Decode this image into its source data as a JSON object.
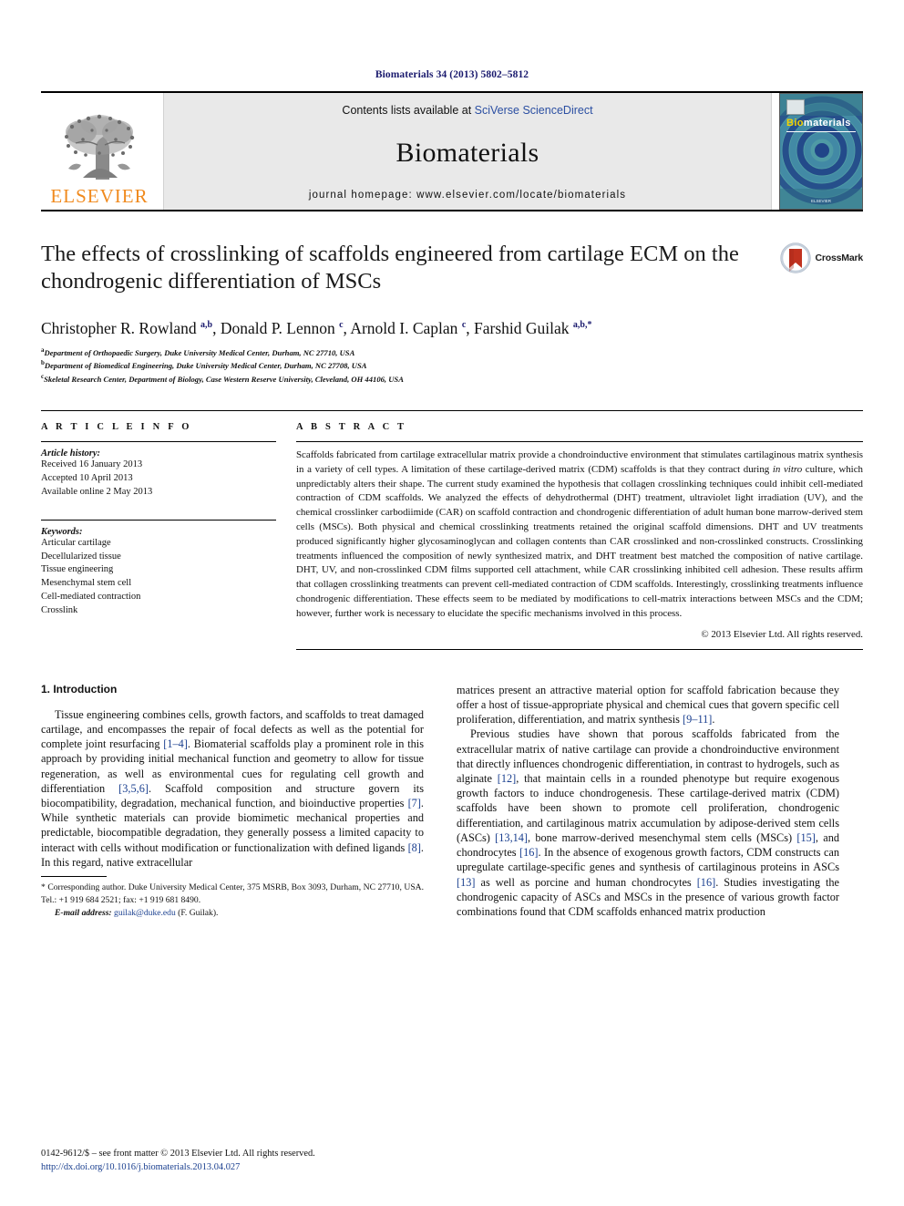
{
  "running_head": "Biomaterials 34 (2013) 5802–5812",
  "masthead": {
    "publisher_name": "ELSEVIER",
    "contents_prefix": "Contents lists available at ",
    "contents_link": "SciVerse ScienceDirect",
    "journal_title": "Biomaterials",
    "homepage": "journal homepage: www.elsevier.com/locate/biomaterials",
    "cover_word_bio": "Bio",
    "cover_word_materials": "materials",
    "cover_footer": "ELSEVIER"
  },
  "article": {
    "title": "The effects of crosslinking of scaffolds engineered from cartilage ECM on the chondrogenic differentiation of MSCs",
    "crossmark_label": "CrossMark",
    "authors_html": "Christopher R. Rowland <sup>a,b</sup>, Donald P. Lennon <sup>c</sup>, Arnold I. Caplan <sup>c</sup>, Farshid Guilak <sup>a,b,</sup><sup>*</sup>",
    "affiliations": [
      "Department of Orthopaedic Surgery, Duke University Medical Center, Durham, NC 27710, USA",
      "Department of Biomedical Engineering, Duke University Medical Center, Durham, NC 27708, USA",
      "Skeletal Research Center, Department of Biology, Case Western Reserve University, Cleveland, OH 44106, USA"
    ],
    "affiliation_marks": [
      "a",
      "b",
      "c"
    ]
  },
  "article_info": {
    "heading": "A R T I C L E  I N F O",
    "history_label": "Article history:",
    "history": [
      "Received 16 January 2013",
      "Accepted 10 April 2013",
      "Available online 2 May 2013"
    ],
    "keywords_label": "Keywords:",
    "keywords": [
      "Articular cartilage",
      "Decellularized tissue",
      "Tissue engineering",
      "Mesenchymal stem cell",
      "Cell-mediated contraction",
      "Crosslink"
    ]
  },
  "abstract": {
    "heading": "A B S T R A C T",
    "paragraph_html": "Scaffolds fabricated from cartilage extracellular matrix provide a chondroinductive environment that stimulates cartilaginous matrix synthesis in a variety of cell types. A limitation of these cartilage-derived matrix (CDM) scaffolds is that they contract during <i>in vitro</i> culture, which unpredictably alters their shape. The current study examined the hypothesis that collagen crosslinking techniques could inhibit cell-mediated contraction of CDM scaffolds. We analyzed the effects of dehydrothermal (DHT) treatment, ultraviolet light irradiation (UV), and the chemical crosslinker carbodiimide (CAR) on scaffold contraction and chondrogenic differentiation of adult human bone marrow-derived stem cells (MSCs). Both physical and chemical crosslinking treatments retained the original scaffold dimensions. DHT and UV treatments produced significantly higher glycosaminoglycan and collagen contents than CAR crosslinked and non-crosslinked constructs. Crosslinking treatments influenced the composition of newly synthesized matrix, and DHT treatment best matched the composition of native cartilage. DHT, UV, and non-crosslinked CDM films supported cell attachment, while CAR crosslinking inhibited cell adhesion. These results affirm that collagen crosslinking treatments can prevent cell-mediated contraction of CDM scaffolds. Interestingly, crosslinking treatments influence chondrogenic differentiation. These effects seem to be mediated by modifications to cell-matrix interactions between MSCs and the CDM; however, further work is necessary to elucidate the specific mechanisms involved in this process.",
    "copyright": "© 2013 Elsevier Ltd. All rights reserved."
  },
  "introduction": {
    "section_number_title": "1. Introduction",
    "left_paragraph_html": "Tissue engineering combines cells, growth factors, and scaffolds to treat damaged cartilage, and encompasses the repair of focal defects as well as the potential for complete joint resurfacing <span class=\"ref\">[1–4]</span>. Biomaterial scaffolds play a prominent role in this approach by providing initial mechanical function and geometry to allow for tissue regeneration, as well as environmental cues for regulating cell growth and differentiation <span class=\"ref\">[3,5,6]</span>. Scaffold composition and structure govern its biocompatibility, degradation, mechanical function, and bioinductive properties <span class=\"ref\">[7]</span>. While synthetic materials can provide biomimetic mechanical properties and predictable, biocompatible degradation, they generally possess a limited capacity to interact with cells without modification or functionalization with defined ligands <span class=\"ref\">[8]</span>. In this regard, native extracellular",
    "right_paragraph_1_html": "matrices present an attractive material option for scaffold fabrication because they offer a host of tissue-appropriate physical and chemical cues that govern specific cell proliferation, differentiation, and matrix synthesis <span class=\"ref\">[9–11]</span>.",
    "right_paragraph_2_html": "Previous studies have shown that porous scaffolds fabricated from the extracellular matrix of native cartilage can provide a chondroinductive environment that directly influences chondrogenic differentiation, in contrast to hydrogels, such as alginate <span class=\"ref\">[12]</span>, that maintain cells in a rounded phenotype but require exogenous growth factors to induce chondrogenesis. These cartilage-derived matrix (CDM) scaffolds have been shown to promote cell proliferation, chondrogenic differentiation, and cartilaginous matrix accumulation by adipose-derived stem cells (ASCs) <span class=\"ref\">[13,14]</span>, bone marrow-derived mesenchymal stem cells (MSCs) <span class=\"ref\">[15]</span>, and chondrocytes <span class=\"ref\">[16]</span>. In the absence of exogenous growth factors, CDM constructs can upregulate cartilage-specific genes and synthesis of cartilaginous proteins in ASCs <span class=\"ref\">[13]</span> as well as porcine and human chondrocytes <span class=\"ref\">[16]</span>. Studies investigating the chondrogenic capacity of ASCs and MSCs in the presence of various growth factor combinations found that CDM scaffolds enhanced matrix production"
  },
  "footnote": {
    "corresponding_html": "* Corresponding author. Duke University Medical Center, 375 MSRB, Box 3093, Durham, NC 27710, USA. Tel.: +1 919 684 2521; fax: +1 919 681 8490.",
    "email_label": "E-mail address:",
    "email": "guilak@duke.edu",
    "email_suffix": "(F. Guilak)."
  },
  "imprint": {
    "issn_line": "0142-9612/$ – see front matter © 2013 Elsevier Ltd. All rights reserved.",
    "doi": "http://dx.doi.org/10.1016/j.biomaterials.2013.04.027"
  },
  "colors": {
    "running_head": "#1a1a6e",
    "elsevier_orange": "#F08A1E",
    "sciencedirect_blue": "#2b4fa2",
    "reference_blue": "#1a3f8f",
    "crossmark_red": "#c1321f",
    "cover_teal": "#2d6f7e"
  }
}
